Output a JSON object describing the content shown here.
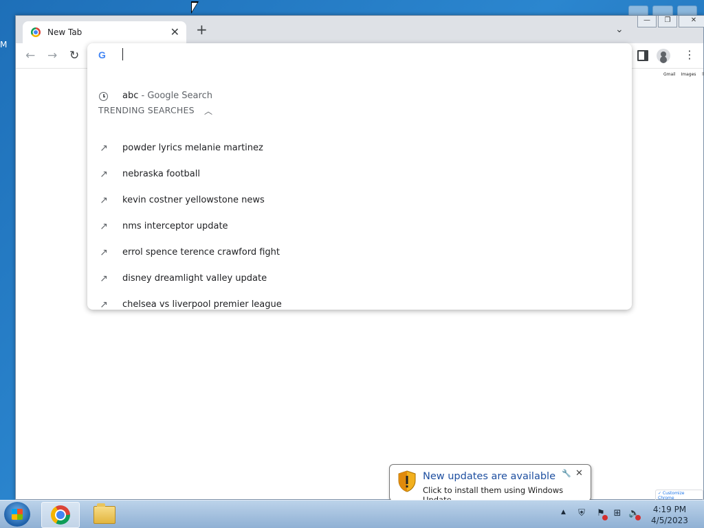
{
  "desktop": {
    "edge_letter": "M"
  },
  "browser": {
    "tab_title": "New Tab",
    "tab_close": "✕",
    "new_tab": "+",
    "page_links": [
      "Gmail",
      "Images"
    ],
    "customize_label": "✓ Customize Chrome"
  },
  "omnibox": {
    "value": "",
    "history_item": {
      "query": "abc",
      "suffix": " - Google Search"
    },
    "trending_header": "TRENDING SEARCHES",
    "trending": [
      "powder lyrics melanie martinez",
      "nebraska football",
      "kevin costner yellowstone news",
      "nms interceptor update",
      "errol spence terence crawford fight",
      "disney dreamlight valley update",
      "chelsea vs liverpool premier league"
    ]
  },
  "notification": {
    "title": "New updates are available",
    "body": "Click to install them using Windows Update."
  },
  "taskbar": {
    "time": "4:19 PM",
    "date": "4/5/2023"
  }
}
